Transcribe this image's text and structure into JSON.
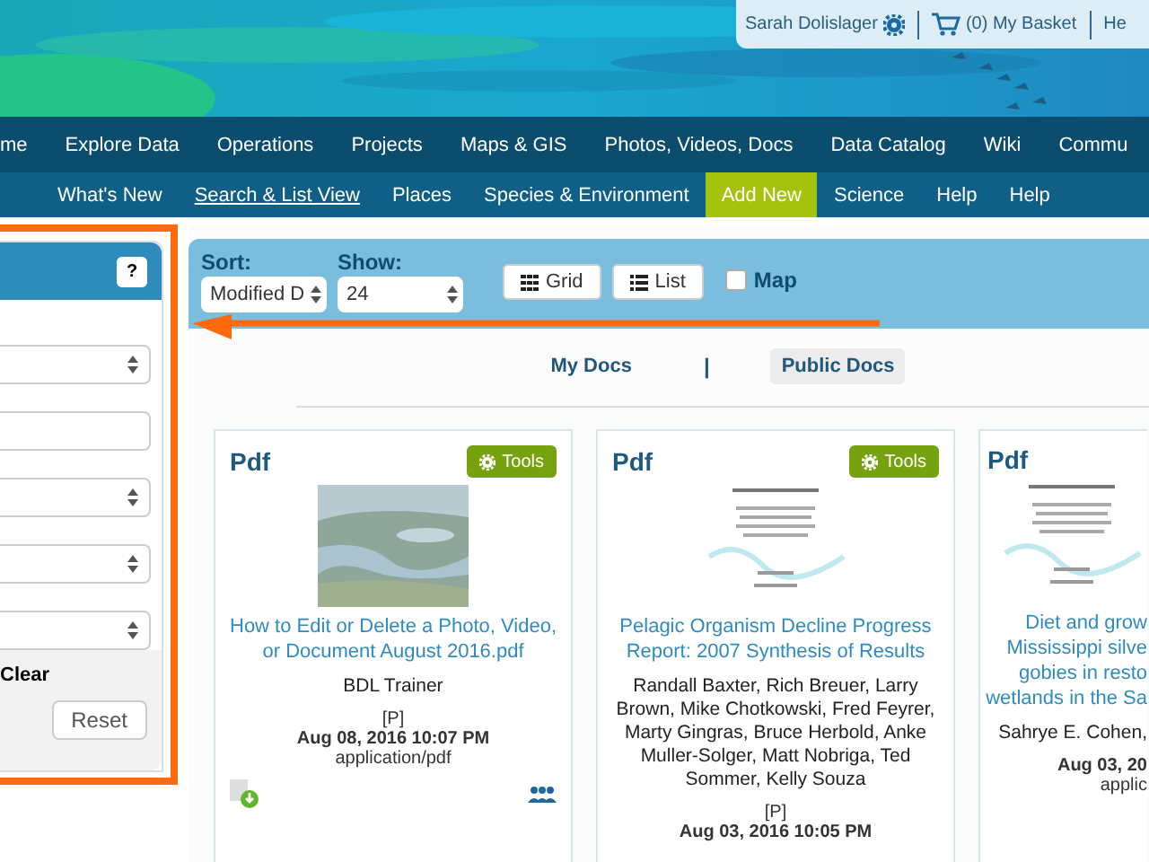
{
  "user_bar": {
    "user": "Sarah Dolislager",
    "basket": "(0) My Basket",
    "help": "He"
  },
  "main_nav": [
    "me",
    "Explore Data",
    "Operations",
    "Projects",
    "Maps & GIS",
    "Photos, Videos, Docs",
    "Data Catalog",
    "Wiki",
    "Commu"
  ],
  "sub_nav": [
    {
      "label": "What's New",
      "selected": false,
      "underlined": false
    },
    {
      "label": "Search & List View",
      "selected": false,
      "underlined": true
    },
    {
      "label": "Places",
      "selected": false,
      "underlined": false
    },
    {
      "label": "Species & Environment",
      "selected": false,
      "underlined": false
    },
    {
      "label": "Add New",
      "selected": true,
      "underlined": false
    },
    {
      "label": "Science",
      "selected": false,
      "underlined": false
    },
    {
      "label": "Help",
      "selected": false,
      "underlined": false
    },
    {
      "label": "Help",
      "selected": false,
      "underlined": false
    }
  ],
  "filter_panel": {
    "help": "?",
    "fields": [
      {
        "kind": "select"
      },
      {
        "kind": "input"
      },
      {
        "kind": "select"
      },
      {
        "kind": "select"
      },
      {
        "kind": "select"
      }
    ],
    "clear": "Clear",
    "reset": "Reset"
  },
  "toolbar": {
    "sort_label": "Sort:",
    "sort_value": "Modified D",
    "show_label": "Show:",
    "show_value": "24",
    "grid": "Grid",
    "list": "List",
    "map": "Map",
    "map_checked": false
  },
  "doc_tabs": [
    {
      "label": "My Docs",
      "selected": false
    },
    {
      "label": "Public Docs",
      "selected": true
    }
  ],
  "doc_tab_separator": "|",
  "cards": [
    {
      "type": "Pdf",
      "tools": "Tools",
      "clipped": false,
      "title_lines": [
        "How to Edit or Delete a Photo, Video,",
        "or Document August 2016.pdf"
      ],
      "authors": "BDL Trainer",
      "flag": "[P]",
      "date": "Aug 08, 2016 10:07 PM",
      "mime": "application/pdf"
    },
    {
      "type": "Pdf",
      "tools": "Tools",
      "kind": "document",
      "clipped": false,
      "title_lines": [
        "Pelagic Organism Decline Progress",
        "Report: 2007 Synthesis of Results"
      ],
      "authors": "Randall Baxter, Rich Breuer, Larry Brown, Mike Chotkowski, Fred Feyrer, Marty Gingras, Bruce Herbold, Anke Muller-Solger, Matt Nobriga, Ted Sommer, Kelly Souza",
      "flag": "[P]",
      "date": "Aug 03, 2016 10:05 PM"
    },
    {
      "type": "Pdf",
      "kind": "document",
      "clipped": true,
      "title_lines": [
        "Diet and grow",
        "Mississippi silve",
        "gobies in resto",
        "wetlands in the Sa"
      ],
      "authors": "Sahrye E. Cohen,",
      "date": "Aug 03, 20",
      "mime": "applic"
    }
  ]
}
